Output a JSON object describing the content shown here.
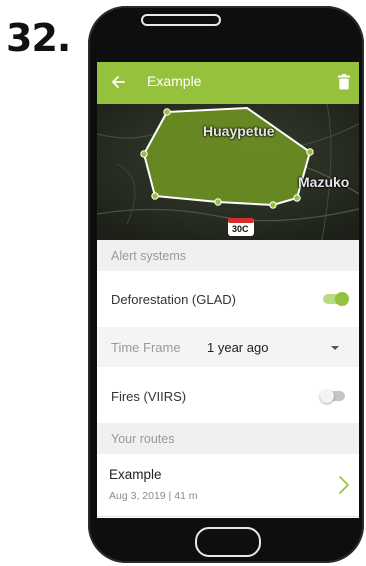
{
  "step": {
    "number": "32."
  },
  "appbar": {
    "title": "Example",
    "back_icon": "arrow-left-icon",
    "delete_icon": "trash-icon",
    "color": "#95c13d"
  },
  "map": {
    "labels": {
      "town1": "Huaypetue",
      "town2": "Mazuko",
      "road_shield": "30C"
    },
    "area_fill": "#6b8f23",
    "outline": "#ffffff",
    "vertex_color": "#95c13d"
  },
  "alert_systems": {
    "header": "Alert systems",
    "deforestation": {
      "label": "Deforestation (GLAD)",
      "enabled": true
    },
    "time_frame": {
      "label": "Time Frame",
      "value": "1 year ago"
    },
    "fires": {
      "label": "Fires (VIIRS)",
      "enabled": false
    }
  },
  "routes": {
    "header": "Your routes",
    "items": [
      {
        "title": "Example",
        "meta": "Aug 3, 2019 | 41 m"
      }
    ]
  },
  "colors": {
    "accent": "#95c13d",
    "toggle_on_track": "#b8dc86",
    "toggle_off_track": "#c4c4c4"
  }
}
